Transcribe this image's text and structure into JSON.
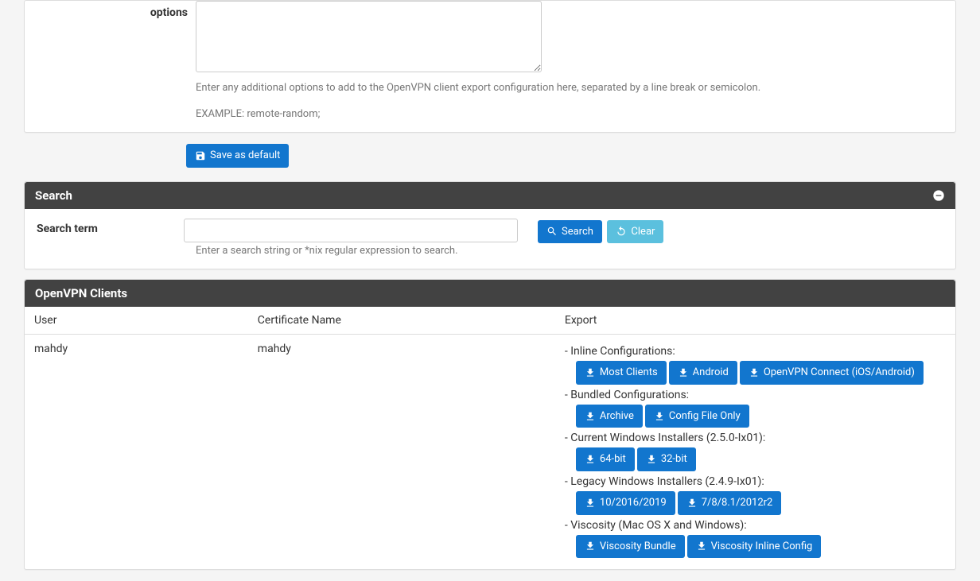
{
  "options_panel": {
    "label": "options",
    "textarea_value": "",
    "help_line1": "Enter any additional options to add to the OpenVPN client export configuration here, separated by a line break or semicolon.",
    "help_line2": "EXAMPLE: remote-random;"
  },
  "save_button_label": "Save as default",
  "search_panel": {
    "title": "Search",
    "label": "Search term",
    "input_value": "",
    "search_btn": "Search",
    "clear_btn": "Clear",
    "help": "Enter a search string or *nix regular expression to search."
  },
  "clients_panel": {
    "title": "OpenVPN Clients",
    "col_user": "User",
    "col_cert": "Certificate Name",
    "col_export": "Export",
    "rows": [
      {
        "user": "mahdy",
        "cert": "mahdy",
        "groups": [
          {
            "label": "Inline Configurations:",
            "buttons": [
              "Most Clients",
              "Android",
              "OpenVPN Connect (iOS/Android)"
            ]
          },
          {
            "label": "Bundled Configurations:",
            "buttons": [
              "Archive",
              "Config File Only"
            ]
          },
          {
            "label": "Current Windows Installers (2.5.0-Ix01):",
            "buttons": [
              "64-bit",
              "32-bit"
            ]
          },
          {
            "label": "Legacy Windows Installers (2.4.9-Ix01):",
            "buttons": [
              "10/2016/2019",
              "7/8/8.1/2012r2"
            ]
          },
          {
            "label": "Viscosity (Mac OS X and Windows):",
            "buttons": [
              "Viscosity Bundle",
              "Viscosity Inline Config"
            ]
          }
        ]
      }
    ]
  }
}
